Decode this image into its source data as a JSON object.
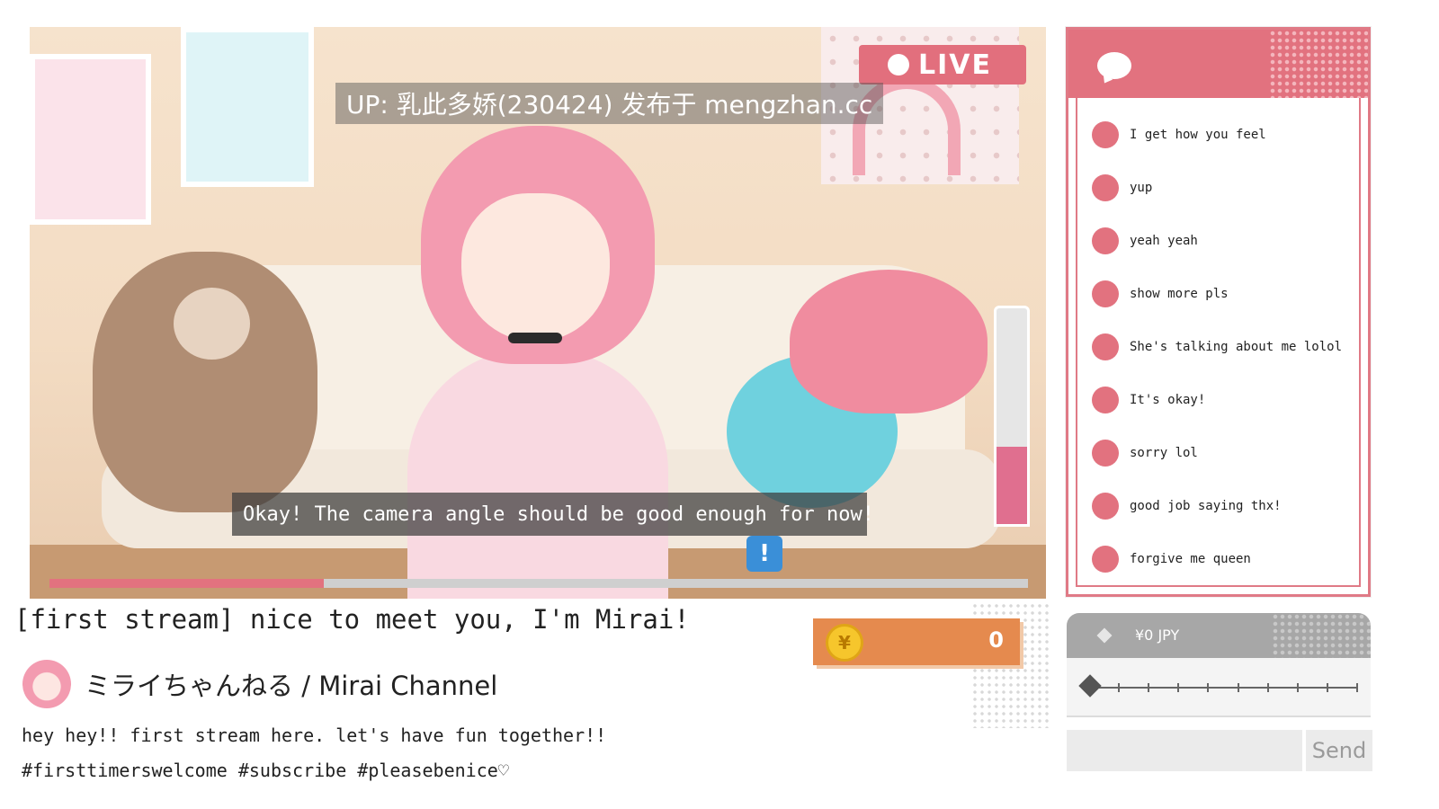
{
  "stream": {
    "live_label": "LIVE",
    "watermark": "UP: 乳此多娇(230424) 发布于 mengzhan.cc",
    "subtitle": "Okay! The camera angle should be good enough for now!",
    "alert_glyph": "!",
    "progress_fraction": 0.28,
    "meter_fraction": 0.36
  },
  "video_info": {
    "title": "[first stream] nice to meet you, I'm Mirai!",
    "channel_name": "ミライちゃんねる / Mirai Channel",
    "description_line1": "hey hey!! first stream here. let's have fun together!!",
    "description_line2": "#firsttimerswelcome #subscribe #pleasebenice♡"
  },
  "coins": {
    "symbol": "¥",
    "count": "0"
  },
  "chat": {
    "icon": "chat-bubble-icon",
    "messages": [
      {
        "text": "I get how you feel"
      },
      {
        "text": "yup"
      },
      {
        "text": "yeah yeah"
      },
      {
        "text": "show more pls"
      },
      {
        "text": "She's talking about me lolol"
      },
      {
        "text": "It's okay!"
      },
      {
        "text": "sorry lol"
      },
      {
        "text": "good job saying thx!"
      },
      {
        "text": "forgive me queen"
      }
    ]
  },
  "tip": {
    "amount_label": "¥0 JPY",
    "slider_ticks": 10,
    "slider_value": 0
  },
  "input": {
    "placeholder": "",
    "send_label": "Send"
  },
  "colors": {
    "accent_pink": "#e2727f",
    "coin_orange": "#e58a4e",
    "meter_pink": "#e06f8f",
    "tip_header_gray": "#a7a7a7"
  }
}
